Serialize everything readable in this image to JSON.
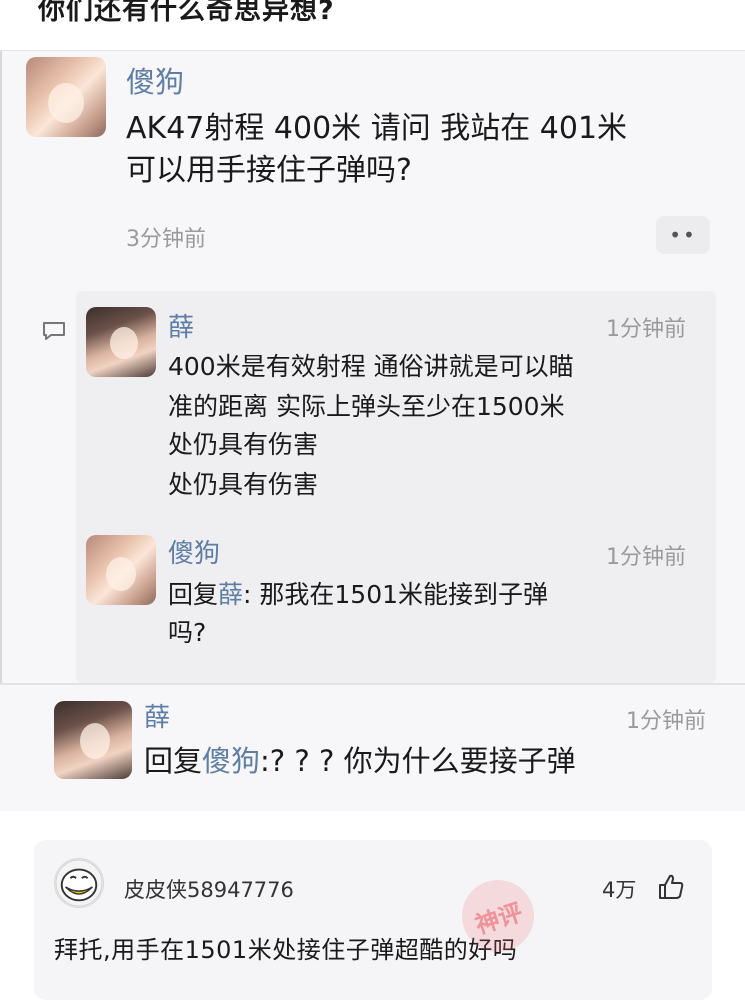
{
  "post": {
    "title": "你们还有什么奇思异想?"
  },
  "screenshot": {
    "original": {
      "author": "傻狗",
      "content_line1": "AK47射程 400米 请问 我站在 401米",
      "content_line2": "可以用手接住子弹吗?",
      "time": "3分钟前",
      "more": "••"
    },
    "replies": [
      {
        "author": "薛",
        "time": "1分钟前",
        "lines": [
          "400米是有效射程 通俗讲就是可以瞄",
          "准的距离 实际上弹头至少在1500米",
          "处仍具有伤害",
          "处仍具有伤害"
        ]
      },
      {
        "author": "傻狗",
        "time": "1分钟前",
        "prefix": "回复",
        "reply_to": "薛",
        "text_line1": ": 那我在1501米能接到子弹",
        "text_line2": "吗?"
      },
      {
        "author": "薛",
        "time": "1分钟前",
        "prefix": "回复",
        "reply_to": "傻狗",
        "text": ":? ? ? 你为什么要接子弹"
      }
    ]
  },
  "comment": {
    "username": "皮皮侠58947776",
    "likes": "4万",
    "text": "拜托,用手在1501米处接住子弹超酷的好吗",
    "stamp": "神评"
  },
  "icons": {
    "comment": "comment-icon",
    "like": "thumbs-up-icon",
    "avatar": "duck-avatar-icon"
  },
  "colors": {
    "name_blue": "#5e7ea6",
    "stamp_red": "#eb5a64"
  }
}
